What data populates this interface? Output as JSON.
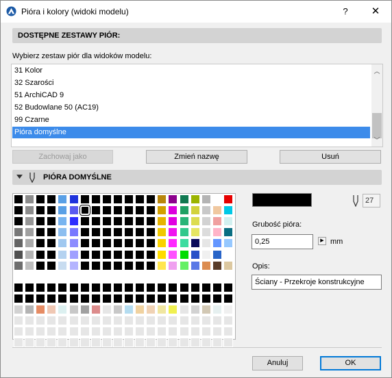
{
  "window": {
    "title": "Pióra i kolory (widoki modelu)",
    "help": "?",
    "close": "✕"
  },
  "sets_section": {
    "title": "DOSTĘPNE ZESTAWY PIÓR:"
  },
  "prompt": "Wybierz zestaw piór dla widoków modelu:",
  "pen_sets": [
    "31 Kolor",
    "32 Szarości",
    "51 ArchiCAD 9",
    "52 Budowlane 50 (AC19)",
    "99 Czarne",
    "Pióra domyślne"
  ],
  "selected_set_index": 5,
  "buttons": {
    "save_as": "Zachowaj jako",
    "rename": "Zmień nazwę",
    "delete": "Usuń",
    "cancel": "Anuluj",
    "ok": "OK"
  },
  "pens_section": {
    "title": "PIÓRA DOMYŚLNE"
  },
  "pen": {
    "number": "27",
    "color": "#000000",
    "weight_label": "Grubość pióra:",
    "weight_value": "0,25",
    "unit": "mm",
    "desc_label": "Opis:",
    "desc_value": "Ściany - Przekroje konstrukcyjne"
  },
  "palette_selected": 27,
  "palette": [
    "#000000",
    "#8c8c8c",
    "#000000",
    "#000000",
    "#5aa0e6",
    "#1e32dc",
    "#000000",
    "#000000",
    "#000000",
    "#000000",
    "#000000",
    "#000000",
    "#000000",
    "#b8860b",
    "#8c008c",
    "#0f7850",
    "#9bb400",
    "#b4b4b4",
    "#ffffff",
    "#e60000",
    "#000000",
    "#8c8c8c",
    "#000000",
    "#000000",
    "#5aa0e6",
    "#5a5af0",
    "#000000",
    "#000000",
    "#000000",
    "#000000",
    "#000000",
    "#000000",
    "#000000",
    "#d2a000",
    "#dc00dc",
    "#1ea064",
    "#d2d23c",
    "#c8c8c8",
    "#f0c8a0",
    "#00c8e6",
    "#000000",
    "#969696",
    "#000000",
    "#000000",
    "#78b4f0",
    "#2d2dff",
    "#000000",
    "#000000",
    "#000000",
    "#000000",
    "#000000",
    "#000000",
    "#000000",
    "#e6b400",
    "#e100e1",
    "#28b478",
    "#dcdc50",
    "#d2d2d2",
    "#f0a0a0",
    "#d2f0f0",
    "#787878",
    "#a0a0a0",
    "#000000",
    "#000000",
    "#8cbef0",
    "#7878ff",
    "#000000",
    "#000000",
    "#000000",
    "#000000",
    "#000000",
    "#000000",
    "#000000",
    "#f0c800",
    "#f014f0",
    "#32c88c",
    "#e6e664",
    "#dcdcdc",
    "#ffb4c8",
    "#0a6e82",
    "#646464",
    "#aaaaaa",
    "#000000",
    "#000000",
    "#a0c8f0",
    "#8c8cff",
    "#000000",
    "#000000",
    "#000000",
    "#000000",
    "#000000",
    "#000000",
    "#000000",
    "#fad200",
    "#ff28ff",
    "#3cdca0",
    "#0a0a5a",
    "#e6e6e6",
    "#6496ff",
    "#96c8ff",
    "#505050",
    "#b4b4b4",
    "#000000",
    "#000000",
    "#b4d2f0",
    "#a0a0ff",
    "#000000",
    "#000000",
    "#000000",
    "#000000",
    "#000000",
    "#000000",
    "#000000",
    "#ffdc00",
    "#ff50ff",
    "#00dc00",
    "#2850c8",
    "#f0f0f0",
    "#2864c8",
    "#ffffff",
    "#6e6e6e",
    "#bebebe",
    "#000000",
    "#000000",
    "#c8dcf0",
    "#b4b4ff",
    "#000000",
    "#000000",
    "#000000",
    "#000000",
    "#000000",
    "#000000",
    "#000000",
    "#ffe650",
    "#f0a0f0",
    "#64f064",
    "#5a78e6",
    "#dc8c50",
    "#5a3c28",
    "#dcc8a0",
    "#ffffff",
    "#ffffff",
    "#ffffff",
    "#ffffff",
    "#ffffff",
    "#ffffff",
    "#ffffff",
    "#ffffff",
    "#ffffff",
    "#ffffff",
    "#ffffff",
    "#ffffff",
    "#ffffff",
    "#ffffff",
    "#ffffff",
    "#ffffff",
    "#ffffff",
    "#ffffff",
    "#ffffff",
    "#ffffff",
    "#000000",
    "#000000",
    "#000000",
    "#000000",
    "#000000",
    "#000000",
    "#000000",
    "#000000",
    "#000000",
    "#000000",
    "#000000",
    "#000000",
    "#000000",
    "#000000",
    "#000000",
    "#000000",
    "#000000",
    "#000000",
    "#000000",
    "#000000",
    "#000000",
    "#000000",
    "#000000",
    "#000000",
    "#000000",
    "#000000",
    "#000000",
    "#000000",
    "#000000",
    "#000000",
    "#000000",
    "#000000",
    "#000000",
    "#000000",
    "#000000",
    "#000000",
    "#000000",
    "#000000",
    "#000000",
    "#000000",
    "#d2d2d2",
    "#b4b4b4",
    "#e68c64",
    "#f0c8b4",
    "#dcf0f0",
    "#c8c8c8",
    "#a0a0a0",
    "#dc8c8c",
    "#e6e6e6",
    "#c8c8c8",
    "#b4dcf0",
    "#f0d2a0",
    "#f0d2b4",
    "#f0e6a0",
    "#f0f050",
    "#e6e6e6",
    "#d2d2d2",
    "#d2c8b4",
    "#e6f0f0",
    "#f0f0f0",
    "#e6e6e6",
    "#e6e6e6",
    "#e6e6e6",
    "#e6e6e6",
    "#e6e6e6",
    "#e6e6e6",
    "#e6e6e6",
    "#e6e6e6",
    "#e6e6e6",
    "#e6e6e6",
    "#e6e6e6",
    "#e6e6e6",
    "#e6e6e6",
    "#e6e6e6",
    "#e6e6e6",
    "#e6e6e6",
    "#e6e6e6",
    "#e6e6e6",
    "#e6e6e6",
    "#e6e6e6",
    "#e6e6e6",
    "#e6e6e6",
    "#e6e6e6",
    "#e6e6e6",
    "#e6e6e6",
    "#e6e6e6",
    "#e6e6e6",
    "#e6e6e6",
    "#e6e6e6",
    "#e6e6e6",
    "#e6e6e6",
    "#e6e6e6",
    "#e6e6e6",
    "#e6e6e6",
    "#e6e6e6",
    "#e6e6e6",
    "#e6e6e6",
    "#e6e6e6",
    "#e6e6e6",
    "#e6e6e6",
    "#e6e6e6",
    "#e6e6e6",
    "#e6e6e6",
    "#e6e6e6",
    "#e6e6e6",
    "#e6e6e6",
    "#e6e6e6",
    "#e6e6e6",
    "#e6e6e6",
    "#e6e6e6",
    "#e6e6e6",
    "#e6e6e6",
    "#e6e6e6",
    "#e6e6e6",
    "#e6e6e6",
    "#e6e6e6",
    "#e6e6e6",
    "#e6e6e6",
    "#e6e6e6",
    "#e6e6e6"
  ]
}
